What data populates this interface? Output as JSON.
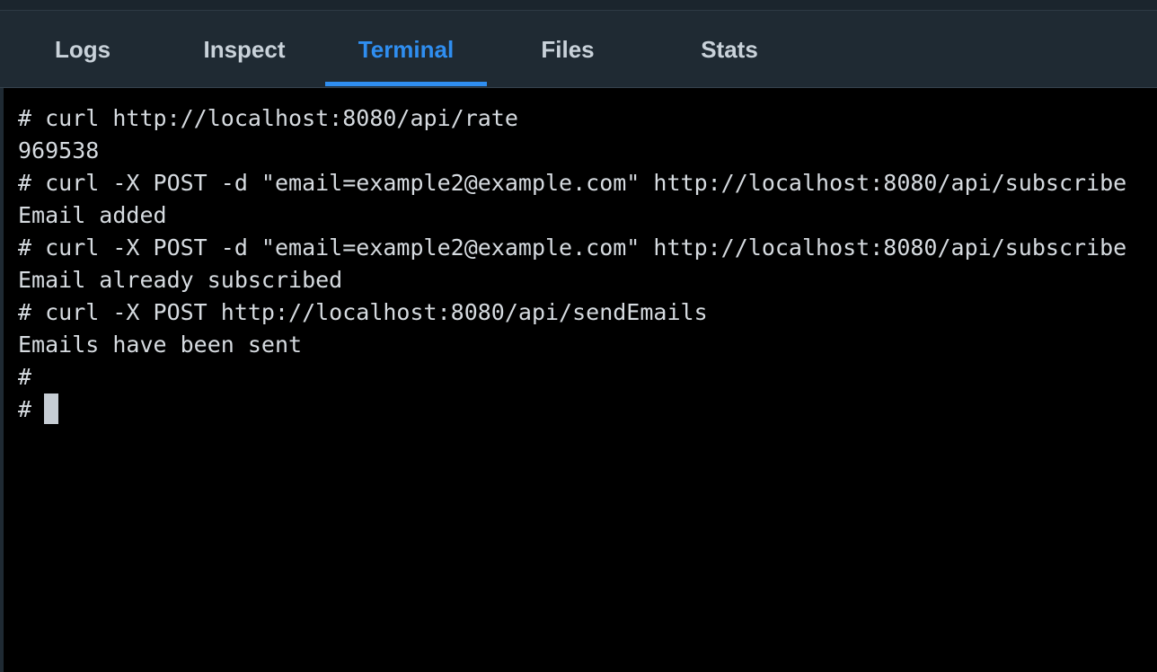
{
  "tabs": [
    {
      "label": "Logs",
      "active": false
    },
    {
      "label": "Inspect",
      "active": false
    },
    {
      "label": "Terminal",
      "active": true
    },
    {
      "label": "Files",
      "active": false
    },
    {
      "label": "Stats",
      "active": false
    }
  ],
  "terminal": {
    "lines": [
      "# curl http://localhost:8080/api/rate",
      "969538",
      "# curl -X POST -d \"email=example2@example.com\" http://localhost:8080/api/subscribe",
      "Email added",
      "# curl -X POST -d \"email=example2@example.com\" http://localhost:8080/api/subscribe",
      "Email already subscribed",
      "# curl -X POST http://localhost:8080/api/sendEmails",
      "Emails have been sent",
      "#"
    ],
    "prompt": "#"
  },
  "colors": {
    "accent": "#2f8ef0",
    "tabbar_bg": "#1f2a33",
    "terminal_bg": "#000000",
    "terminal_text": "#d6dbe0"
  }
}
